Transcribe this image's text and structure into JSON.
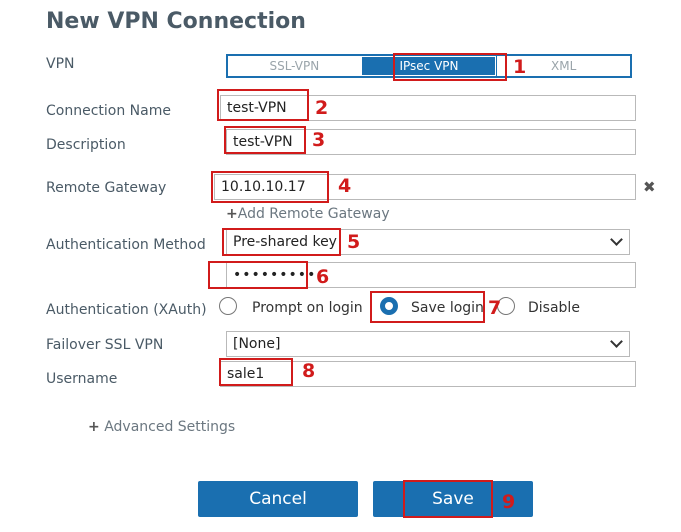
{
  "title": "New VPN Connection",
  "vpn": {
    "label": "VPN",
    "options": [
      "SSL-VPN",
      "IPsec VPN",
      "XML"
    ],
    "selected": "IPsec VPN"
  },
  "connection_name": {
    "label": "Connection Name",
    "value": "test-VPN"
  },
  "description": {
    "label": "Description",
    "value": "test-VPN"
  },
  "remote_gateway": {
    "label": "Remote Gateway",
    "value": "10.10.10.17",
    "add_label": "Add Remote Gateway"
  },
  "auth_method": {
    "label": "Authentication Method",
    "value": "Pre-shared key",
    "key_value": "•••••••••"
  },
  "xauth": {
    "label": "Authentication (XAuth)",
    "options": [
      "Prompt on login",
      "Save login",
      "Disable"
    ],
    "selected": "Save login"
  },
  "failover": {
    "label": "Failover SSL VPN",
    "value": "[None]"
  },
  "username": {
    "label": "Username",
    "value": "sale1"
  },
  "advanced": {
    "label": "Advanced Settings"
  },
  "buttons": {
    "cancel": "Cancel",
    "save": "Save"
  },
  "steps": [
    "1",
    "2",
    "3",
    "4",
    "5",
    "6",
    "7",
    "8",
    "9"
  ],
  "colors": {
    "accent": "#1a6fb0",
    "annotation": "#d11b1b"
  }
}
